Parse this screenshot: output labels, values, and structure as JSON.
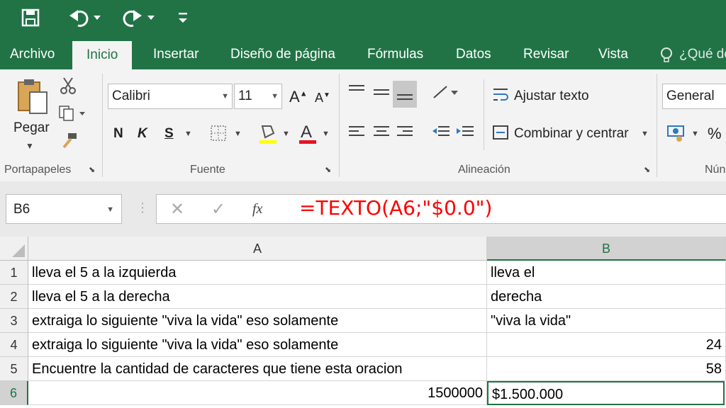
{
  "titlebar": {
    "save_icon": "save-icon",
    "undo_icon": "undo-icon",
    "redo_icon": "redo-icon",
    "customize_icon": "customize-icon"
  },
  "tabs": [
    {
      "label": "Archivo"
    },
    {
      "label": "Inicio"
    },
    {
      "label": "Insertar"
    },
    {
      "label": "Diseño de página"
    },
    {
      "label": "Fórmulas"
    },
    {
      "label": "Datos"
    },
    {
      "label": "Revisar"
    },
    {
      "label": "Vista"
    }
  ],
  "tell_me": "¿Qué de",
  "ribbon": {
    "clipboard": {
      "paste_label": "Pegar",
      "group": "Portapapeles"
    },
    "font": {
      "name": "Calibri",
      "size": "11",
      "bold": "N",
      "italic": "K",
      "underline": "S",
      "group": "Fuente",
      "highlight_color": "#ffff00",
      "font_color": "#e81123"
    },
    "alignment": {
      "wrap_label": "Ajustar texto",
      "merge_label": "Combinar y centrar",
      "group": "Alineación"
    },
    "number": {
      "format": "General",
      "percent": "%",
      "group": "Nún"
    }
  },
  "formula_bar": {
    "name_box": "B6",
    "fx": "fx",
    "formula": "=TEXTO(A6;\"$0.0\")",
    "formula_color": "#ff0000"
  },
  "sheet": {
    "columns": [
      {
        "label": "A"
      },
      {
        "label": "B"
      }
    ],
    "rows": [
      {
        "num": "1",
        "a": "lleva el 5 a la izquierda",
        "b": "lleva el"
      },
      {
        "num": "2",
        "a": "lleva el 5 a la derecha",
        "b": "derecha"
      },
      {
        "num": "3",
        "a": "extraiga lo siguiente \"viva la vida\" eso solamente",
        "b": "\"viva la vida\""
      },
      {
        "num": "4",
        "a": "extraiga lo siguiente \"viva la vida\" eso solamente",
        "b": "24"
      },
      {
        "num": "5",
        "a": "Encuentre la cantidad de caracteres que tiene esta oracion",
        "b": "58"
      },
      {
        "num": "6",
        "a": "1500000",
        "b": "$1.500.000"
      }
    ]
  },
  "colors": {
    "accent": "#217346"
  }
}
